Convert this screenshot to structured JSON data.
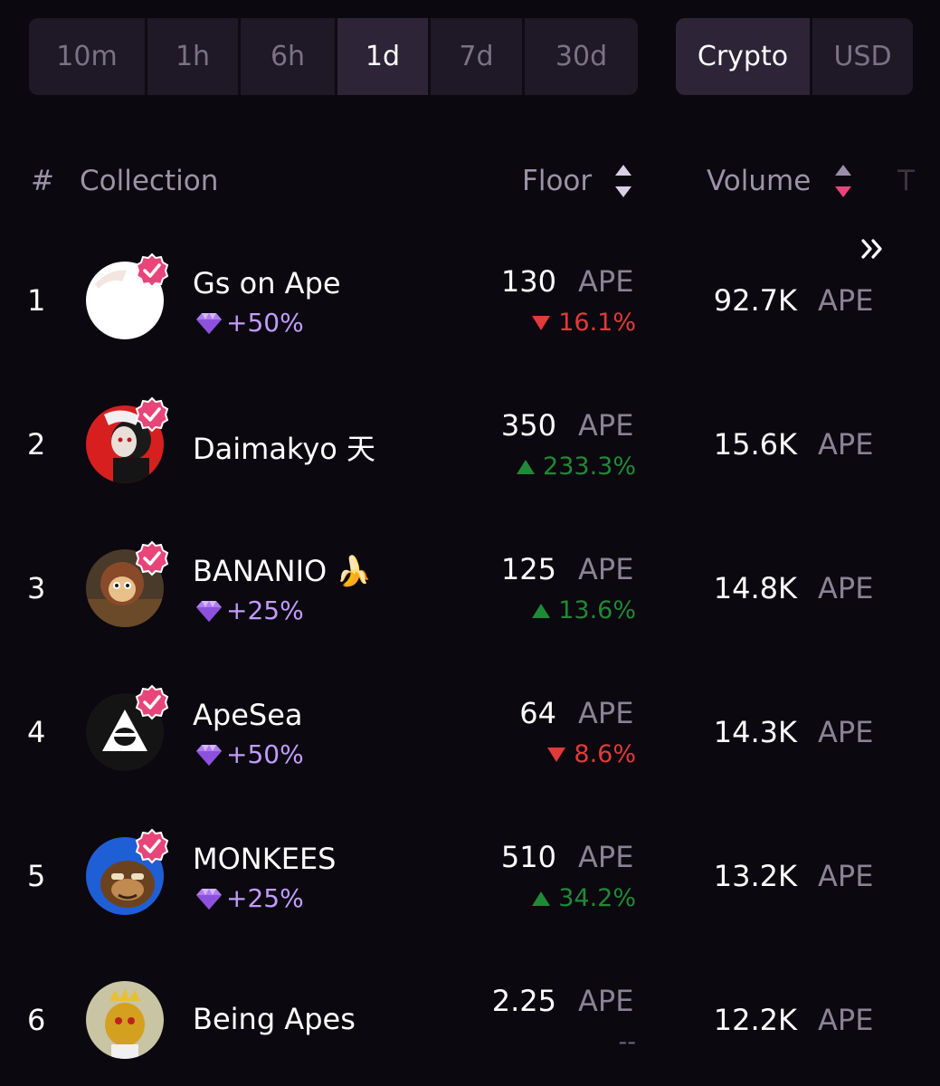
{
  "time_ranges": {
    "options": [
      "10m",
      "1h",
      "6h",
      "1d",
      "7d",
      "30d"
    ],
    "selected": "1d"
  },
  "currency": {
    "options": [
      "Crypto",
      "USD"
    ],
    "selected": "Crypto"
  },
  "table": {
    "headers": {
      "rank": "#",
      "collection": "Collection",
      "floor": "Floor",
      "volume": "Volume",
      "next": "T"
    },
    "rows": [
      {
        "rank": "1",
        "name": "Gs on Ape",
        "reward": "+50%",
        "floor": "130",
        "floor_unit": "APE",
        "change": "16.1%",
        "direction": "down",
        "volume": "92.7K",
        "volume_unit": "APE",
        "verified": true
      },
      {
        "rank": "2",
        "name": "Daimakyo 天",
        "reward": "",
        "floor": "350",
        "floor_unit": "APE",
        "change": "233.3%",
        "direction": "up",
        "volume": "15.6K",
        "volume_unit": "APE",
        "verified": true
      },
      {
        "rank": "3",
        "name": "BANANIO 🍌",
        "reward": "+25%",
        "floor": "125",
        "floor_unit": "APE",
        "change": "13.6%",
        "direction": "up",
        "volume": "14.8K",
        "volume_unit": "APE",
        "verified": true
      },
      {
        "rank": "4",
        "name": "ApeSea",
        "reward": "+50%",
        "floor": "64",
        "floor_unit": "APE",
        "change": "8.6%",
        "direction": "down",
        "volume": "14.3K",
        "volume_unit": "APE",
        "verified": true
      },
      {
        "rank": "5",
        "name": "MONKEES",
        "reward": "+25%",
        "floor": "510",
        "floor_unit": "APE",
        "change": "34.2%",
        "direction": "up",
        "volume": "13.2K",
        "volume_unit": "APE",
        "verified": true
      },
      {
        "rank": "6",
        "name": "Being Apes",
        "reward": "",
        "floor": "2.25",
        "floor_unit": "APE",
        "change": "--",
        "direction": "none",
        "volume": "12.2K",
        "volume_unit": "APE",
        "verified": false
      }
    ]
  },
  "colors": {
    "background": "#0b080f",
    "down": "#e23a3a",
    "up": "#1f8a36",
    "reward": "#c39bff",
    "verified_badge": "#e8457a"
  }
}
